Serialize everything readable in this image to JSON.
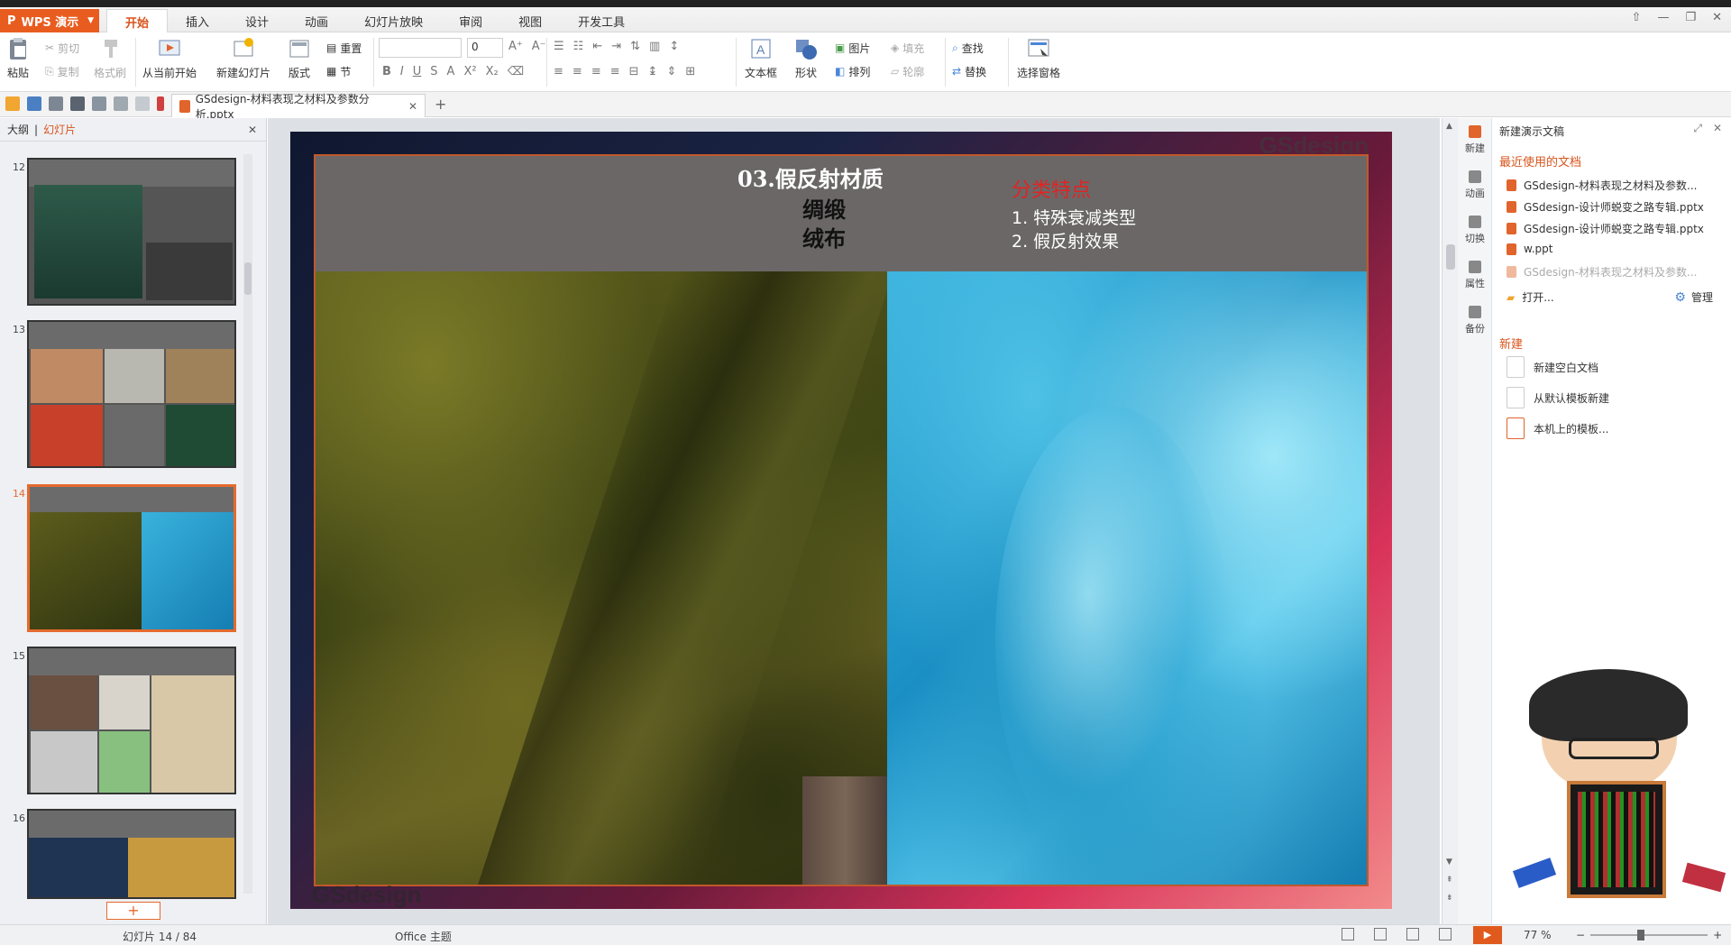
{
  "app": {
    "name": "WPS 演示",
    "menu_tabs": [
      "开始",
      "插入",
      "设计",
      "动画",
      "幻灯片放映",
      "审阅",
      "视图",
      "开发工具"
    ],
    "active_tab": "开始"
  },
  "ribbon": {
    "paste": "粘贴",
    "cut": "剪切",
    "copy": "复制",
    "format_painter": "格式刷",
    "from_current": "从当前开始",
    "new_slide": "新建幻灯片",
    "layout": "版式",
    "reset": "重置",
    "section": "节",
    "font_size": "0",
    "textbox": "文本框",
    "shape": "形状",
    "picture": "图片",
    "fill": "填充",
    "arrange": "排列",
    "outline": "轮廓",
    "find": "查找",
    "replace": "替换",
    "selection_pane": "选择窗格"
  },
  "document_tab": {
    "filename": "GSdesign-材料表现之材料及参数分析.pptx"
  },
  "left_panel": {
    "tab_outline": "大纲",
    "tab_slides": "幻灯片",
    "slide_numbers": [
      "12",
      "13",
      "14",
      "15",
      "16"
    ],
    "selected": "14",
    "add_button": "+"
  },
  "slide": {
    "title": "03.假反射材质",
    "sub1": "绸缎",
    "sub2": "绒布",
    "feature_title": "分类特点",
    "features": [
      "1. 特殊衰减类型",
      "2. 假反射效果"
    ],
    "watermark_top": "GSdesign",
    "watermark_bottom": "GSdesign"
  },
  "task_pane": {
    "header": "新建演示文稿",
    "side_tabs": [
      "新建",
      "动画",
      "切换",
      "属性",
      "备份"
    ],
    "recent_title": "最近使用的文档",
    "recent_files": [
      "GSdesign-材料表现之材料及参数...",
      "GSdesign-设计师蜕变之路专辑.pptx",
      "GSdesign-设计师蜕变之路专辑.pptx",
      "w.ppt",
      "GSdesign-材料表现之材料及参数..."
    ],
    "open": "打开...",
    "manage": "管理",
    "new_title": "新建",
    "new_items": [
      "新建空白文档",
      "从默认模板新建",
      "本机上的模板..."
    ]
  },
  "status_bar": {
    "slide_info": "幻灯片 14 / 84",
    "theme": "Office 主题",
    "zoom": "77 %"
  },
  "colors": {
    "accent": "#e85d1f",
    "section_title": "#d8541c",
    "feature_title": "#e02424"
  }
}
